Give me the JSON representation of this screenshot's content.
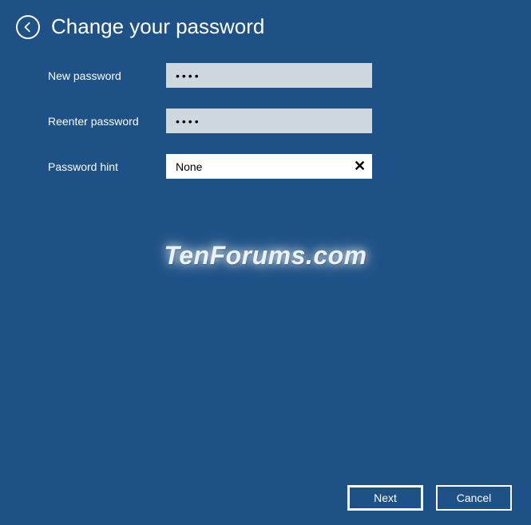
{
  "header": {
    "title": "Change your password"
  },
  "form": {
    "new_password": {
      "label": "New password",
      "value": "••••"
    },
    "reenter_password": {
      "label": "Reenter password",
      "value": "••••"
    },
    "password_hint": {
      "label": "Password hint",
      "value": "None"
    }
  },
  "watermark": "TenForums.com",
  "buttons": {
    "next": "Next",
    "cancel": "Cancel"
  }
}
